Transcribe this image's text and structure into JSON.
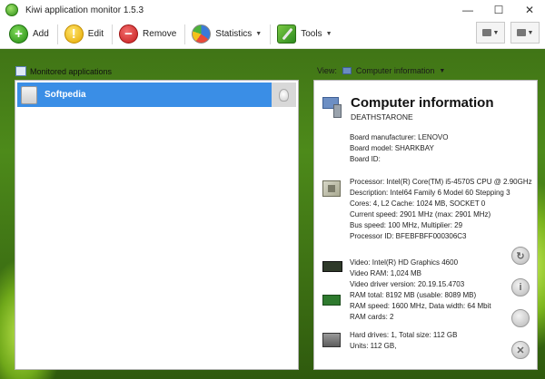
{
  "window": {
    "title": "Kiwi application monitor 1.5.3",
    "controls": {
      "minimize": "—",
      "maximize": "☐",
      "close": "✕"
    }
  },
  "toolbar": {
    "add_label": "Add",
    "edit_label": "Edit",
    "remove_label": "Remove",
    "statistics_label": "Statistics",
    "tools_label": "Tools",
    "add_icon": "plus-icon",
    "edit_icon": "exclamation-icon",
    "remove_icon": "minus-icon",
    "statistics_icon": "pie-chart-icon",
    "tools_icon": "wrench-icon"
  },
  "left_panel": {
    "title": "Monitored applications",
    "items": [
      {
        "label": "Softpedia"
      }
    ]
  },
  "right_panel": {
    "view_label": "View:",
    "view_value": "Computer information",
    "heading": "Computer information",
    "computer_name": "DEATHSTARONE",
    "board": {
      "manufacturer": "Board manufacturer: LENOVO",
      "model": "Board model: SHARKBAY",
      "id": "Board ID:"
    },
    "processor": {
      "name": "Processor: Intel(R) Core(TM) i5-4570S CPU @ 2.90GHz",
      "description": "Description: Intel64 Family 6 Model 60 Stepping 3",
      "cores": "Cores: 4, L2 Cache: 1024 MB, SOCKET 0",
      "speed": "Current speed: 2901 MHz  (max: 2901 MHz)",
      "bus": "Bus speed: 100 MHz, Multiplier: 29",
      "id": "Processor ID: BFEBFBFF000306C3"
    },
    "video": {
      "name": "Video: Intel(R) HD Graphics 4600",
      "ram": "Video RAM: 1,024 MB",
      "driver": "Video driver version: 20.19.15.4703"
    },
    "memory": {
      "total": "RAM total: 8192 MB (usable: 8089 MB)",
      "speed": "RAM speed: 1600 MHz, Data width: 64 Mbit",
      "cards": "RAM cards: 2"
    },
    "disk": {
      "drives": "Hard drives: 1, Total size: 112 GB",
      "units": "Units: 112 GB,"
    }
  },
  "side_buttons": {
    "refresh_icon": "refresh-icon",
    "info_icon": "info-icon",
    "blank_icon": "circle-icon",
    "close_icon": "close-icon"
  },
  "colors": {
    "selection": "#3a8ee6",
    "background_green": "#4d8a1a"
  }
}
